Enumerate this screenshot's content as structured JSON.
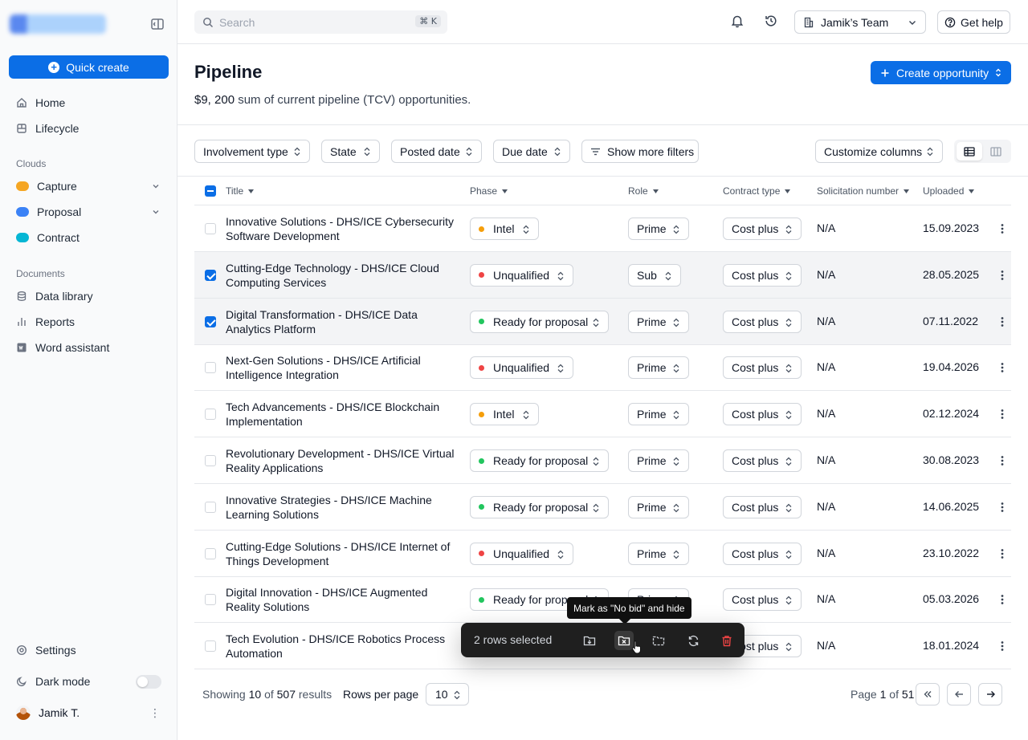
{
  "sidebar": {
    "quick_create": "Quick create",
    "items": [
      {
        "label": "Home"
      },
      {
        "label": "Lifecycle"
      }
    ],
    "clouds_label": "Clouds",
    "clouds": [
      {
        "label": "Capture",
        "color": "#f5a623"
      },
      {
        "label": "Proposal",
        "color": "#3b82f6"
      },
      {
        "label": "Contract",
        "color": "#06b6d4"
      }
    ],
    "documents_label": "Documents",
    "documents": [
      {
        "label": "Data library"
      },
      {
        "label": "Reports"
      },
      {
        "label": "Word assistant"
      }
    ],
    "settings": "Settings",
    "dark_mode": "Dark mode",
    "dark_mode_on": false,
    "user_name": "Jamik T."
  },
  "topbar": {
    "search_placeholder": "Search",
    "search_shortcut": "⌘ K",
    "team": "Jamik’s Team",
    "help": "Get help"
  },
  "header": {
    "title": "Pipeline",
    "amount": "$9, 200",
    "subtitle_rest": " sum of current pipeline (TCV) opportunities.",
    "create_button": "Create opportunity"
  },
  "filters": {
    "involvement": "Involvement type",
    "state": "State",
    "posted": "Posted date",
    "due": "Due date",
    "more": "Show more filters",
    "customize": "Customize columns"
  },
  "table": {
    "columns": [
      "Title",
      "Phase",
      "Role",
      "Contract type",
      "Solicitation number",
      "Uploaded"
    ],
    "rows": [
      {
        "title": "Innovative Solutions - DHS/ICE Cybersecurity Software Development",
        "phase": "Intel",
        "phase_color": "#f59e0b",
        "role": "Prime",
        "contract": "Cost plus",
        "solicitation": "N/A",
        "uploaded": "15.09.2023",
        "selected": false
      },
      {
        "title": "Cutting-Edge Technology - DHS/ICE Cloud Computing Services",
        "phase": "Unqualified",
        "phase_color": "#ef4444",
        "role": "Sub",
        "contract": "Cost plus",
        "solicitation": "N/A",
        "uploaded": "28.05.2025",
        "selected": true
      },
      {
        "title": "Digital Transformation - DHS/ICE Data Analytics Platform",
        "phase": "Ready for proposal",
        "phase_color": "#22c55e",
        "role": "Prime",
        "contract": "Cost plus",
        "solicitation": "N/A",
        "uploaded": "07.11.2022",
        "selected": true
      },
      {
        "title": "Next-Gen Solutions - DHS/ICE Artificial Intelligence Integration",
        "phase": "Unqualified",
        "phase_color": "#ef4444",
        "role": "Prime",
        "contract": "Cost plus",
        "solicitation": "N/A",
        "uploaded": "19.04.2026",
        "selected": false
      },
      {
        "title": "Tech Advancements - DHS/ICE Blockchain Implementation",
        "phase": "Intel",
        "phase_color": "#f59e0b",
        "role": "Prime",
        "contract": "Cost plus",
        "solicitation": "N/A",
        "uploaded": "02.12.2024",
        "selected": false
      },
      {
        "title": "Revolutionary Development - DHS/ICE Virtual Reality Applications",
        "phase": "Ready for proposal",
        "phase_color": "#22c55e",
        "role": "Prime",
        "contract": "Cost plus",
        "solicitation": "N/A",
        "uploaded": "30.08.2023",
        "selected": false
      },
      {
        "title": "Innovative Strategies - DHS/ICE Machine Learning Solutions",
        "phase": "Ready for proposal",
        "phase_color": "#22c55e",
        "role": "Prime",
        "contract": "Cost plus",
        "solicitation": "N/A",
        "uploaded": "14.06.2025",
        "selected": false
      },
      {
        "title": "Cutting-Edge Solutions - DHS/ICE Internet of Things Development",
        "phase": "Unqualified",
        "phase_color": "#ef4444",
        "role": "Prime",
        "contract": "Cost plus",
        "solicitation": "N/A",
        "uploaded": "23.10.2022",
        "selected": false
      },
      {
        "title": "Digital Innovation - DHS/ICE Augmented Reality Solutions",
        "phase": "Ready for proposal",
        "phase_color": "#22c55e",
        "role": "Prime",
        "contract": "Cost plus",
        "solicitation": "N/A",
        "uploaded": "05.03.2026",
        "selected": false
      },
      {
        "title": "Tech Evolution - DHS/ICE Robotics Process Automation",
        "phase": "",
        "phase_color": "",
        "role": "",
        "contract": "Cost plus",
        "solicitation": "N/A",
        "uploaded": "18.01.2024",
        "selected": false
      }
    ]
  },
  "footer": {
    "showing": "Showing",
    "shown": "10",
    "of": "of",
    "total": "507",
    "results": "results",
    "rows_per_page_label": "Rows per page",
    "rows_per_page": "10",
    "page_label": "Page",
    "page": "1",
    "page_of": "of",
    "pages": "51"
  },
  "selection": {
    "count_label": "2 rows selected",
    "tooltip": "Mark as \"No bid\" and hide"
  },
  "colors": {
    "accent": "#0b6ee6",
    "delete": "#ef4444"
  }
}
